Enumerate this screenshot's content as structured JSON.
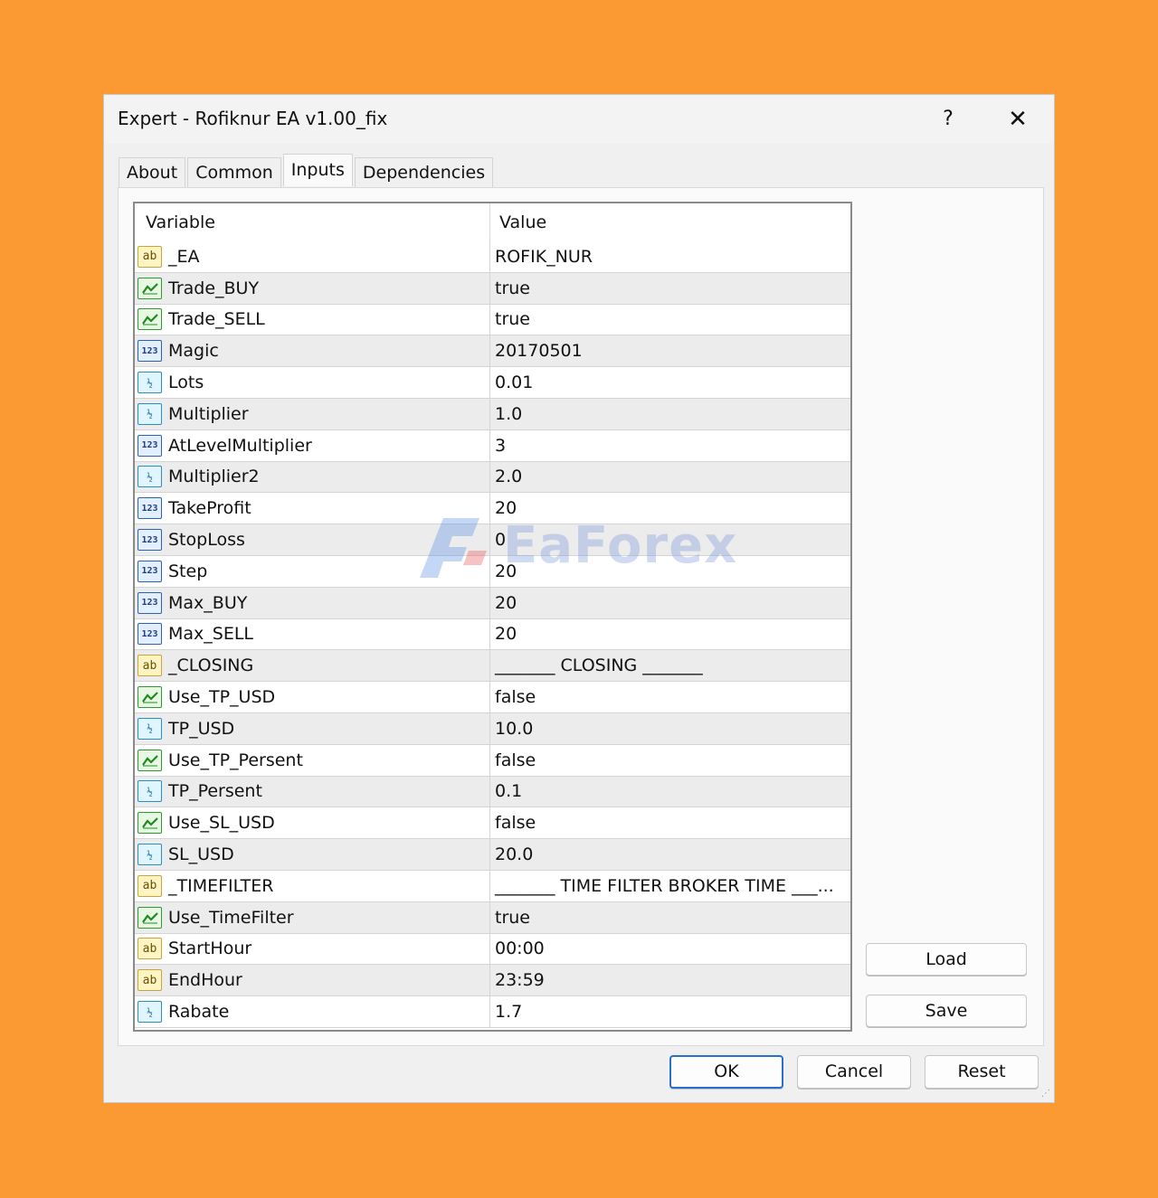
{
  "window": {
    "title": "Expert - Rofiknur EA v1.00_fix",
    "help_label": "?",
    "close_label": "✕"
  },
  "tabs": [
    {
      "label": "About"
    },
    {
      "label": "Common"
    },
    {
      "label": "Inputs",
      "active": true
    },
    {
      "label": "Dependencies"
    }
  ],
  "grid": {
    "col_variable": "Variable",
    "col_value": "Value",
    "rows": [
      {
        "type": "ab",
        "name": "_EA",
        "value": "ROFIK_NUR"
      },
      {
        "type": "bool",
        "name": "Trade_BUY",
        "value": "true"
      },
      {
        "type": "bool",
        "name": "Trade_SELL",
        "value": "true"
      },
      {
        "type": "int",
        "name": "Magic",
        "value": "20170501"
      },
      {
        "type": "dbl",
        "name": "Lots",
        "value": "0.01"
      },
      {
        "type": "dbl",
        "name": "Multiplier",
        "value": "1.0"
      },
      {
        "type": "int",
        "name": "AtLevelMultiplier",
        "value": "3"
      },
      {
        "type": "dbl",
        "name": "Multiplier2",
        "value": "2.0"
      },
      {
        "type": "int",
        "name": "TakeProfit",
        "value": "20"
      },
      {
        "type": "int",
        "name": "StopLoss",
        "value": "0"
      },
      {
        "type": "int",
        "name": "Step",
        "value": "20"
      },
      {
        "type": "int",
        "name": "Max_BUY",
        "value": "20"
      },
      {
        "type": "int",
        "name": "Max_SELL",
        "value": "20"
      },
      {
        "type": "ab",
        "name": "_CLOSING",
        "value": "_______ CLOSING _______"
      },
      {
        "type": "bool",
        "name": "Use_TP_USD",
        "value": "false"
      },
      {
        "type": "dbl",
        "name": "TP_USD",
        "value": "10.0"
      },
      {
        "type": "bool",
        "name": "Use_TP_Persent",
        "value": "false"
      },
      {
        "type": "dbl",
        "name": "TP_Persent",
        "value": "0.1"
      },
      {
        "type": "bool",
        "name": "Use_SL_USD",
        "value": "false"
      },
      {
        "type": "dbl",
        "name": "SL_USD",
        "value": "20.0"
      },
      {
        "type": "ab",
        "name": "_TIMEFILTER",
        "value": "_______ TIME FILTER BROKER TIME ___..."
      },
      {
        "type": "bool",
        "name": "Use_TimeFilter",
        "value": "true"
      },
      {
        "type": "ab",
        "name": "StartHour",
        "value": "00:00"
      },
      {
        "type": "ab",
        "name": "EndHour",
        "value": "23:59"
      },
      {
        "type": "dbl",
        "name": "Rabate",
        "value": "1.7"
      }
    ]
  },
  "icons": {
    "ab": {
      "name": "string-type-icon",
      "glyph": "ab"
    },
    "bool": {
      "name": "bool-type-icon",
      "glyph": ""
    },
    "int": {
      "name": "integer-type-icon",
      "glyph": "123"
    },
    "dbl": {
      "name": "double-type-icon",
      "glyph": "½"
    }
  },
  "buttons": {
    "load": "Load",
    "save": "Save",
    "ok": "OK",
    "cancel": "Cancel",
    "reset": "Reset"
  },
  "watermark": {
    "text": "EaForex"
  },
  "colors": {
    "background": "#fb9a33",
    "dialog": "#f0f0f0",
    "row_alt": "#ececec",
    "primary_border": "#2a6fcf"
  }
}
